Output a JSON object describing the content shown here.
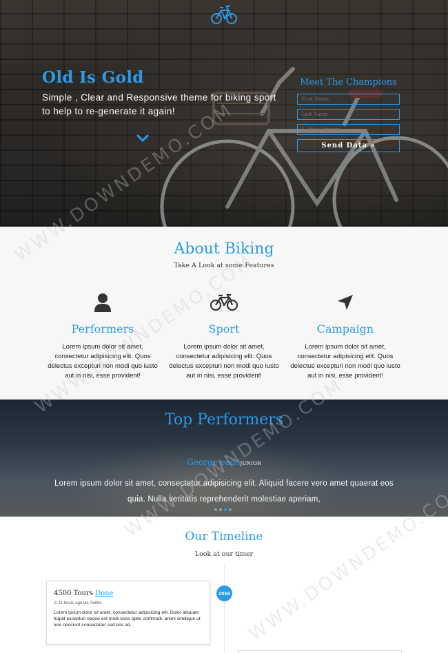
{
  "hero": {
    "title": "Old Is Gold",
    "subtitle": "Simple , Clear and Responsive theme for biking sport to help to re-generate it again!",
    "form": {
      "heading": "Meet The Champions",
      "first_name_placeholder": "First Name",
      "last_name_placeholder": "Last Name",
      "email_placeholder": "E- Mail Address",
      "submit_label": "Send Data »"
    }
  },
  "about": {
    "title": "About Biking",
    "tagline": "Take A Look at some Features",
    "features": [
      {
        "title": "Performers",
        "icon": "user-icon",
        "text": "Lorem ipsum dolor sit amet, consectetur adipisicing elit. Quos delectus excepturi non modi quo iusto aut in nisi, esse provident!"
      },
      {
        "title": "Sport",
        "icon": "bicycle-icon",
        "text": "Lorem ipsum dolor sit amet, consectetur adipisicing elit. Quos delectus excepturi non modi quo iusto aut in nisi, esse provident!"
      },
      {
        "title": "Campaign",
        "icon": "location-arrow-icon",
        "text": "Lorem ipsum dolor sit amet, consectetur adipisicing elit. Quos delectus excepturi non modi quo iusto aut in nisi, esse provident!"
      }
    ]
  },
  "performers": {
    "title": "Top Performers",
    "name": "George eado",
    "rank": "JUNIOR",
    "quote": "Lorem ipsum dolor sit amet, consectetur adipisicing elit. Aliquid facere vero amet quaerat eos quia. Nulla veritatis reprehenderit molestiae aperiam,"
  },
  "timeline": {
    "title": "Our Timeline",
    "tagline": "Look at our timer",
    "year": "2016",
    "entry": {
      "title": "4500 Tours",
      "link": "Done",
      "meta": "⊙ 11 hours ago via Twitter",
      "text": "Lorem ipsum dolor sit amet, consectetur adipisicing elit. Dolor aliquam fugiat excepturi neque est modi esse optio commodi, animi similique ut iure nesciunt consectetur sed eos ad."
    }
  },
  "watermarks": [
    "WWW.DOWNDEMO.COM",
    "WWW.DOWNDEMO.COM",
    "WWW.DOWNDEMO.COM",
    "WWW.DOWNDEMO.COM"
  ],
  "colors": {
    "accent": "#2b9be8"
  }
}
